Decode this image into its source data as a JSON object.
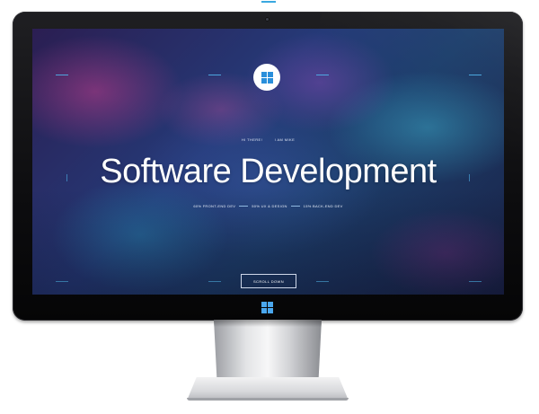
{
  "hero": {
    "nav_items": [
      "HI THERE!",
      "I AM MIKE"
    ],
    "headline": "Software Development",
    "skills": [
      "60% FRONT-END DEV",
      "50% UX & DESIGN",
      "15% BACK-END DEV"
    ],
    "scroll_label": "SCROLL DOWN",
    "accent_color": "#4fb3ea"
  },
  "icons": {
    "screen_logo": "windows-logo-icon",
    "bezel_logo": "windows-logo-icon",
    "camera": "webcam-icon"
  },
  "colors": {
    "windows_blue": "#2a8fdb",
    "bezel": "#111113"
  }
}
